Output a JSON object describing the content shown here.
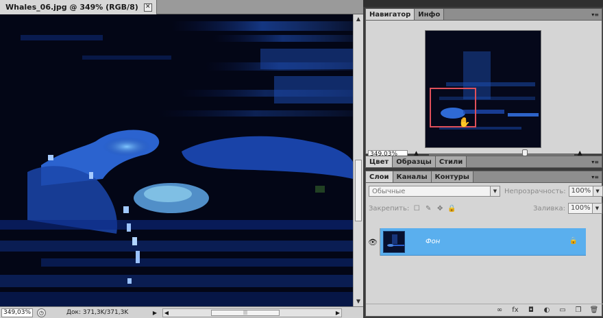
{
  "document": {
    "tab_title": "Whales_06.jpg @ 349% (RGB/8)",
    "close_glyph": "✕",
    "status": {
      "zoom": "349,03%",
      "doc_info": "Док: 371,3K/371,3K",
      "status_icon": "◷",
      "menu_arrow": "▶",
      "scroll_left": "◀",
      "scroll_right": "▶",
      "scroll_up": "▲",
      "scroll_down": "▼",
      "thumb_grip": "|||"
    }
  },
  "navigator_group": {
    "tabs": [
      "Навигатор",
      "Инфо"
    ],
    "active_tab": "Навигатор",
    "menu_icon": "▾≡",
    "zoom": "349,03%",
    "zoom_out_icon": "▲",
    "zoom_in_icon": "▲",
    "slider_level": 0.66,
    "hand_icon": "✋"
  },
  "color_group": {
    "tabs": [
      "Цвет",
      "Образцы",
      "Стили"
    ],
    "active_tab": "Цвет",
    "menu_icon": "▾≡"
  },
  "layers_group": {
    "tabs": [
      "Слои",
      "Каналы",
      "Контуры"
    ],
    "active_tab": "Слои",
    "menu_icon": "▾≡",
    "blend_mode": "Обычные",
    "opacity_label": "Непрозрачность:",
    "opacity_value": "100%",
    "lock_label": "Закрепить:",
    "fill_label": "Заливка:",
    "fill_value": "100%",
    "dropdown_glyph": "▼",
    "lock_icons": [
      "☐",
      "✎",
      "✥",
      "🔒"
    ],
    "layers": [
      {
        "name": "Фон",
        "visible": true,
        "locked": true,
        "selected": true
      }
    ],
    "eye_icon": "👁",
    "lock_glyph": "🔒",
    "footer_icons": [
      "∞",
      "fx",
      "◘",
      "◐",
      "▭",
      "❐",
      "🗑"
    ]
  },
  "colors": {
    "selection": "#5aafee",
    "nav_rect": "#e0505a",
    "canvas_bg": "#030616"
  }
}
